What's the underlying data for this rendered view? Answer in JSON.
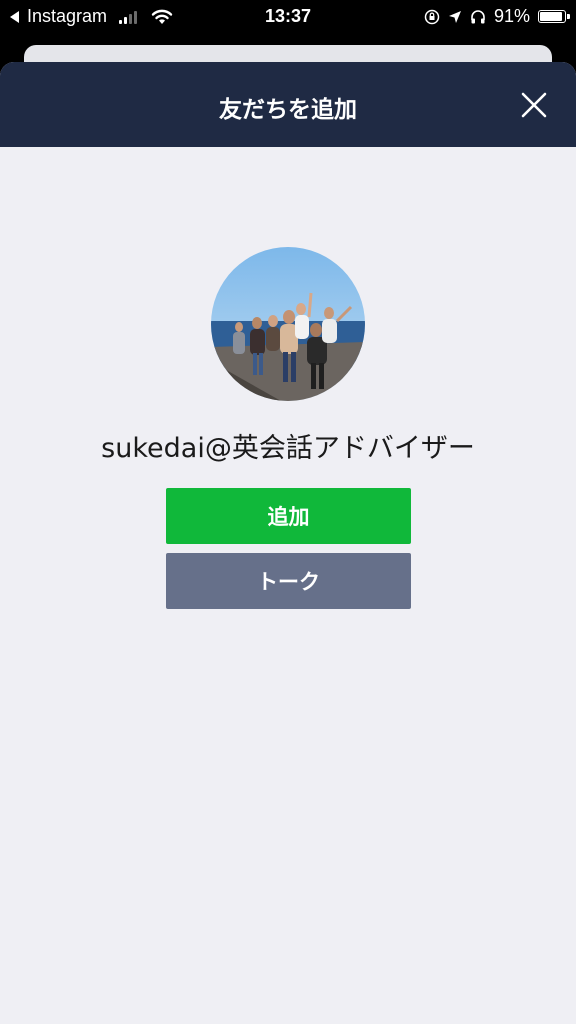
{
  "status_bar": {
    "back_app": "Instagram",
    "time": "13:37",
    "battery_percent": "91%",
    "battery_level": 0.91,
    "signal_bars": 2
  },
  "sheet": {
    "title": "友だちを追加",
    "close_icon": "close-icon"
  },
  "profile": {
    "name": "sukedai@英会話アドバイザー",
    "avatar_icon": "group-photo"
  },
  "buttons": {
    "add_label": "追加",
    "talk_label": "トーク"
  },
  "colors": {
    "header_bg": "#1f2a44",
    "add_button": "#10b83a",
    "talk_button": "#66708a",
    "sheet_bg": "#efeff4"
  }
}
